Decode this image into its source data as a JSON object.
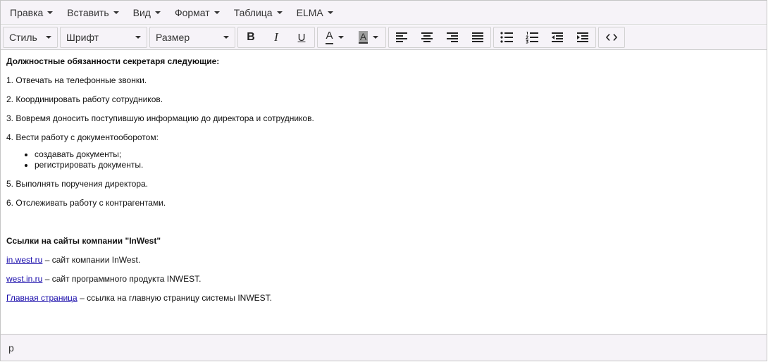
{
  "menubar": {
    "items": [
      "Правка",
      "Вставить",
      "Вид",
      "Формат",
      "Таблица",
      "ELMA"
    ]
  },
  "toolbar": {
    "style_label": "Стиль",
    "font_label": "Шрифт",
    "size_label": "Размер",
    "bold_label": "B",
    "italic_label": "I",
    "underline_label": "U",
    "font_color_letter": "A",
    "bg_color_letter": "A",
    "icons": [
      "align-left-icon",
      "align-center-icon",
      "align-right-icon",
      "align-justify-icon",
      "bullet-list-icon",
      "numbered-list-icon",
      "outdent-icon",
      "indent-icon",
      "source-code-icon"
    ]
  },
  "content": {
    "heading1": "Должностные обязанности секретаря следующие:",
    "items": [
      "1. Отвечать на телефонные звонки.",
      "2. Координировать работу сотрудников.",
      "3. Вовремя доносить поступившую информацию до директора и сотрудников.",
      "4. Вести работу с документооборотом:"
    ],
    "bullets": [
      "создавать документы;",
      "регистрировать документы."
    ],
    "items2": [
      "5. Выполнять поручения директора.",
      "6. Отслеживать работу с контрагентами."
    ],
    "heading2": "Ссылки на сайты компании \"InWest\"",
    "links": [
      {
        "text": "in.west.ru",
        "desc": " – сайт компании InWest."
      },
      {
        "text": "west.in.ru",
        "desc": " – сайт программного продукта INWEST."
      },
      {
        "text": "Главная страница",
        "desc": " – ссылка на главную страницу системы INWEST."
      }
    ]
  },
  "statusbar": {
    "path": "p"
  }
}
